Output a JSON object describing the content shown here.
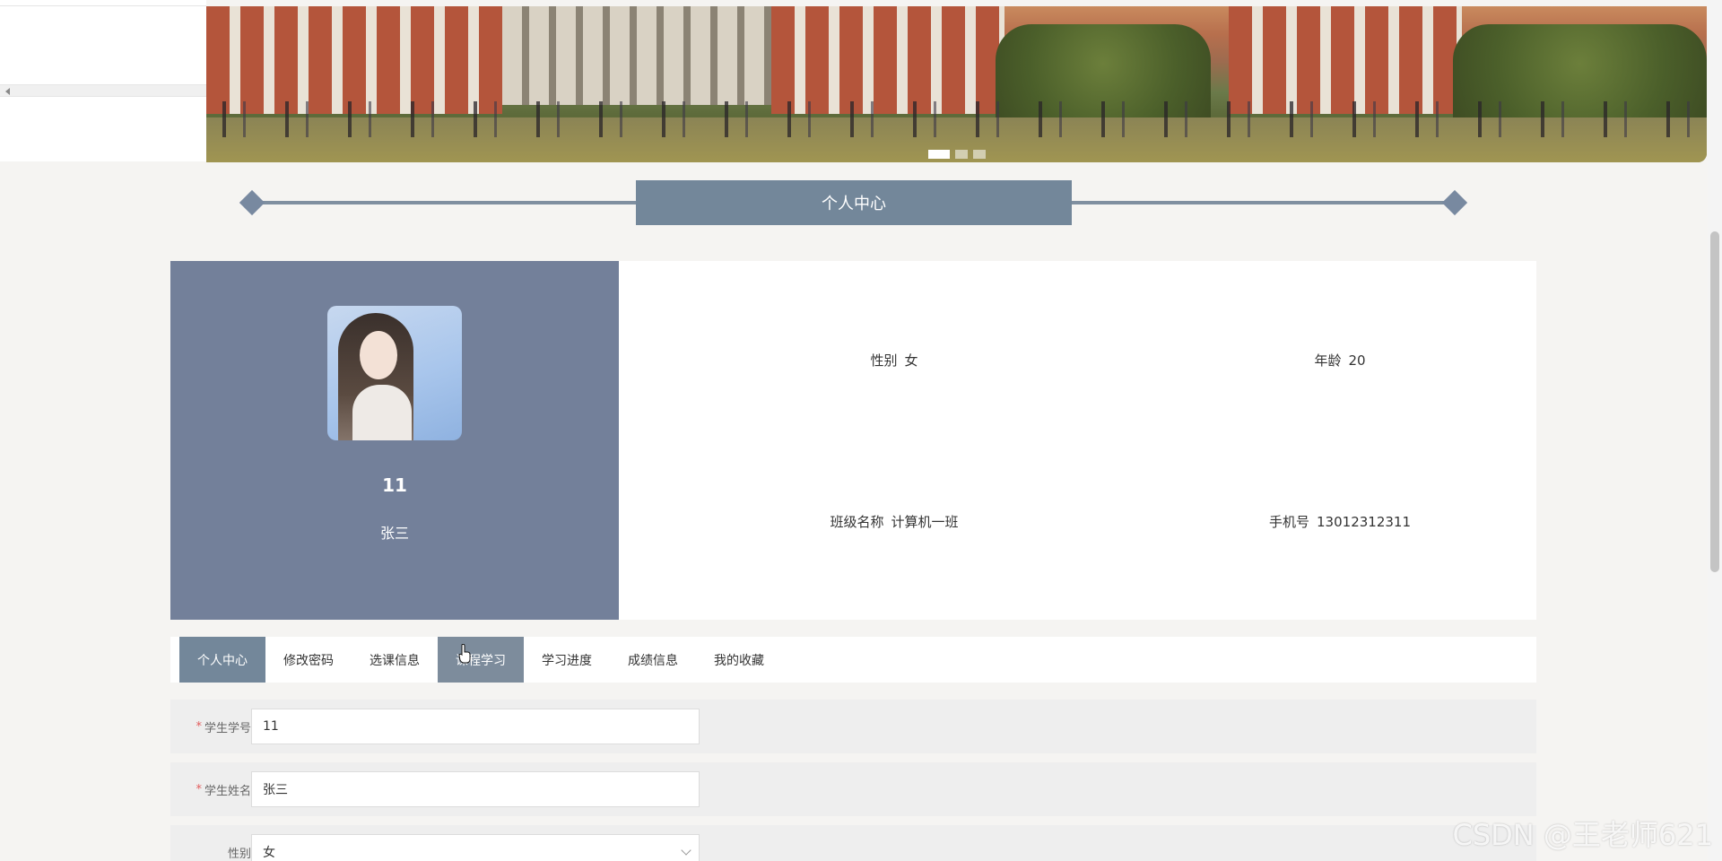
{
  "carousel": {
    "slides": 3,
    "active_index": 0
  },
  "section_title": "个人中心",
  "profile": {
    "user_id": "11",
    "name": "张三",
    "fields": [
      {
        "label": "性别",
        "value": "女"
      },
      {
        "label": "年龄",
        "value": "20"
      },
      {
        "label": "班级名称",
        "value": "计算机一班"
      },
      {
        "label": "手机号",
        "value": "13012312311"
      }
    ]
  },
  "tabs": [
    {
      "label": "个人中心",
      "state": "active"
    },
    {
      "label": "修改密码",
      "state": "normal"
    },
    {
      "label": "选课信息",
      "state": "normal"
    },
    {
      "label": "课程学习",
      "state": "hover"
    },
    {
      "label": "学习进度",
      "state": "normal"
    },
    {
      "label": "成绩信息",
      "state": "normal"
    },
    {
      "label": "我的收藏",
      "state": "normal"
    }
  ],
  "form": {
    "student_no": {
      "label": "学生学号",
      "required": true,
      "value": "11"
    },
    "student_name": {
      "label": "学生姓名",
      "required": true,
      "value": "张三"
    },
    "gender": {
      "label": "性别",
      "required": false,
      "value": "女"
    }
  },
  "watermark": "CSDN @王老师621",
  "colors": {
    "accent": "#73879a",
    "profile_panel": "#73809a",
    "required": "#e25c5c"
  }
}
